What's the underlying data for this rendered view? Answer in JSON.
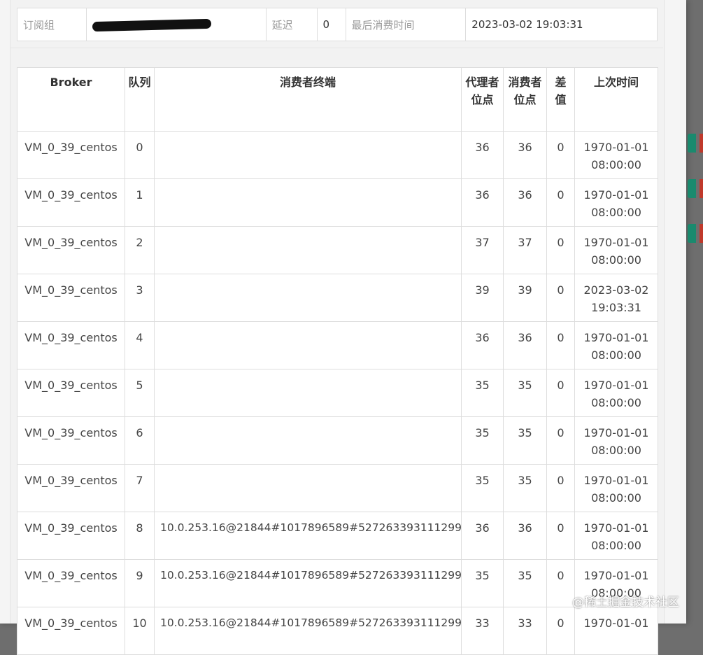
{
  "info": {
    "group_label": "订阅组",
    "delay_label": "延迟",
    "delay_value": "0",
    "last_consume_label": "最后消费时间",
    "last_consume_value": "2023-03-02 19:03:31"
  },
  "table": {
    "headers": [
      "Broker",
      "队列",
      "消费者终端",
      "代理者位点",
      "消费者位点",
      "差值",
      "上次时间"
    ],
    "rows": [
      {
        "broker": "VM_0_39_centos",
        "queue": "0",
        "client": "",
        "broker_offset": "36",
        "consumer_offset": "36",
        "diff": "0",
        "time": "1970-01-01 08:00:00"
      },
      {
        "broker": "VM_0_39_centos",
        "queue": "1",
        "client": "",
        "broker_offset": "36",
        "consumer_offset": "36",
        "diff": "0",
        "time": "1970-01-01 08:00:00"
      },
      {
        "broker": "VM_0_39_centos",
        "queue": "2",
        "client": "",
        "broker_offset": "37",
        "consumer_offset": "37",
        "diff": "0",
        "time": "1970-01-01 08:00:00"
      },
      {
        "broker": "VM_0_39_centos",
        "queue": "3",
        "client": "",
        "broker_offset": "39",
        "consumer_offset": "39",
        "diff": "0",
        "time": "2023-03-02 19:03:31"
      },
      {
        "broker": "VM_0_39_centos",
        "queue": "4",
        "client": "",
        "broker_offset": "36",
        "consumer_offset": "36",
        "diff": "0",
        "time": "1970-01-01 08:00:00"
      },
      {
        "broker": "VM_0_39_centos",
        "queue": "5",
        "client": "",
        "broker_offset": "35",
        "consumer_offset": "35",
        "diff": "0",
        "time": "1970-01-01 08:00:00"
      },
      {
        "broker": "VM_0_39_centos",
        "queue": "6",
        "client": "",
        "broker_offset": "35",
        "consumer_offset": "35",
        "diff": "0",
        "time": "1970-01-01 08:00:00"
      },
      {
        "broker": "VM_0_39_centos",
        "queue": "7",
        "client": "",
        "broker_offset": "35",
        "consumer_offset": "35",
        "diff": "0",
        "time": "1970-01-01 08:00:00"
      },
      {
        "broker": "VM_0_39_centos",
        "queue": "8",
        "client": "10.0.253.16@21844#1017896589#527263393111299",
        "broker_offset": "36",
        "consumer_offset": "36",
        "diff": "0",
        "time": "1970-01-01 08:00:00"
      },
      {
        "broker": "VM_0_39_centos",
        "queue": "9",
        "client": "10.0.253.16@21844#1017896589#527263393111299",
        "broker_offset": "35",
        "consumer_offset": "35",
        "diff": "0",
        "time": "1970-01-01 08:00:00"
      },
      {
        "broker": "VM_0_39_centos",
        "queue": "10",
        "client": "10.0.253.16@21844#1017896589#527263393111299",
        "broker_offset": "33",
        "consumer_offset": "33",
        "diff": "0",
        "time": "1970-01-01"
      }
    ]
  },
  "watermark": "@稀土掘金技术社区",
  "colors": {
    "accent_green": "#1a8a6e",
    "accent_red": "#c0392b"
  }
}
